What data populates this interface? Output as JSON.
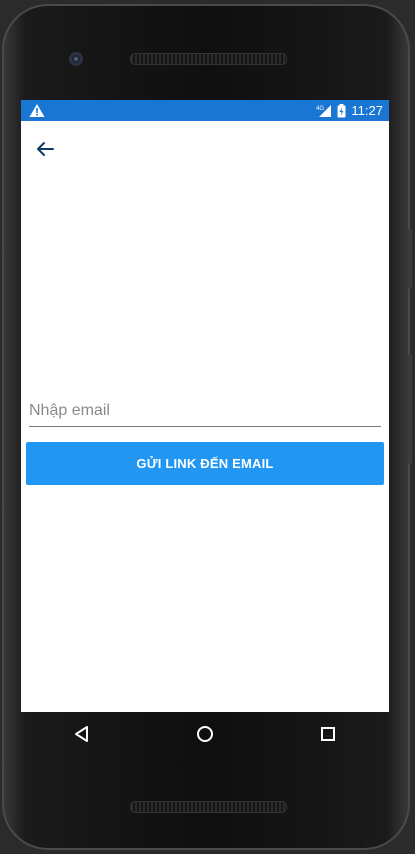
{
  "status_bar": {
    "time": "11:27",
    "network_label": "4G",
    "icons": [
      "warning-icon",
      "signal-icon",
      "battery-icon"
    ],
    "color": "#1976d2"
  },
  "app_bar": {
    "back_icon": "arrow-left-icon",
    "icon_color": "#0d3b66"
  },
  "form": {
    "email_placeholder": "Nhập email",
    "email_value": "",
    "submit_label": "GỬI LINK ĐẾN EMAIL",
    "button_color": "#2196f3"
  },
  "nav_bar": {
    "items": [
      "back-triangle-icon",
      "home-circle-icon",
      "recents-square-icon"
    ]
  }
}
